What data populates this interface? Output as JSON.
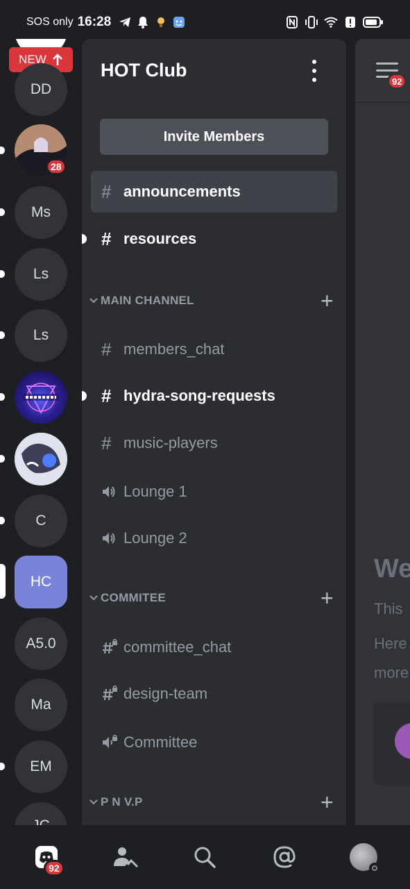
{
  "status_bar": {
    "sos_text": "SOS only",
    "time": "16:28",
    "icons_left": [
      "telegram-icon",
      "bell-icon",
      "notification-app-icon",
      "app-icon"
    ],
    "icons_right": [
      "nfc-icon",
      "vibrate-icon",
      "wifi-icon",
      "alert-icon",
      "battery-icon"
    ]
  },
  "server_rail": {
    "new_tag": "NEW",
    "servers": [
      {
        "label": "DD",
        "kind": "text",
        "unread": false,
        "badge": ""
      },
      {
        "label": "",
        "kind": "image",
        "unread": true,
        "badge": "28"
      },
      {
        "label": "Ms",
        "kind": "text",
        "unread": true,
        "badge": ""
      },
      {
        "label": "Ls",
        "kind": "text",
        "unread": true,
        "badge": ""
      },
      {
        "label": "Ls",
        "kind": "text",
        "unread": true,
        "badge": ""
      },
      {
        "label": "",
        "kind": "image",
        "unread": true,
        "badge": ""
      },
      {
        "label": "",
        "kind": "image",
        "unread": true,
        "badge": ""
      },
      {
        "label": "C",
        "kind": "text",
        "unread": true,
        "badge": ""
      },
      {
        "label": "HC",
        "kind": "text",
        "unread": false,
        "badge": "",
        "active": true
      },
      {
        "label": "A5.0",
        "kind": "text",
        "unread": false,
        "badge": ""
      },
      {
        "label": "Ma",
        "kind": "text",
        "unread": false,
        "badge": ""
      },
      {
        "label": "EM",
        "kind": "text",
        "unread": true,
        "badge": ""
      },
      {
        "label": "JC",
        "kind": "text",
        "unread": false,
        "badge": ""
      }
    ]
  },
  "panel": {
    "guild_name": "HOT Club",
    "invite_label": "Invite Members",
    "top_channels": [
      {
        "name": "announcements",
        "type": "text",
        "state": "selected"
      },
      {
        "name": "resources",
        "type": "text",
        "state": "unread"
      }
    ],
    "categories": [
      {
        "name": "MAIN CHANNEL",
        "channels": [
          {
            "name": "members_chat",
            "type": "text",
            "state": "read"
          },
          {
            "name": "hydra-song-requests",
            "type": "text",
            "state": "unread"
          },
          {
            "name": "music-players",
            "type": "text",
            "state": "read"
          },
          {
            "name": "Lounge 1",
            "type": "voice",
            "state": "read"
          },
          {
            "name": "Lounge 2",
            "type": "voice",
            "state": "read"
          }
        ]
      },
      {
        "name": "COMMITEE",
        "channels": [
          {
            "name": "committee_chat",
            "type": "locked-text",
            "state": "read"
          },
          {
            "name": "design-team",
            "type": "locked-text",
            "state": "read"
          },
          {
            "name": "Committee",
            "type": "locked-voice",
            "state": "read"
          }
        ]
      },
      {
        "name": "P N V.P",
        "channels": []
      }
    ]
  },
  "chat_preview": {
    "header_badge": "92",
    "welcome_fragment": "We",
    "line1": "This",
    "line2": "Here",
    "line3": "more"
  },
  "bottom_nav": {
    "items": [
      {
        "name": "home",
        "icon": "discord-icon",
        "badge": "92"
      },
      {
        "name": "friends",
        "icon": "friends-icon",
        "badge": ""
      },
      {
        "name": "search",
        "icon": "search-icon",
        "badge": ""
      },
      {
        "name": "mentions",
        "icon": "at-icon",
        "badge": ""
      },
      {
        "name": "profile",
        "icon": "avatar-icon",
        "badge": ""
      }
    ]
  },
  "colors": {
    "background": "#1e1f22",
    "panel": "#2b2d31",
    "chat": "#313338",
    "selected": "#404249",
    "accent_server": "#7983d8",
    "badge": "#da373c",
    "new_tag": "#da373c"
  }
}
